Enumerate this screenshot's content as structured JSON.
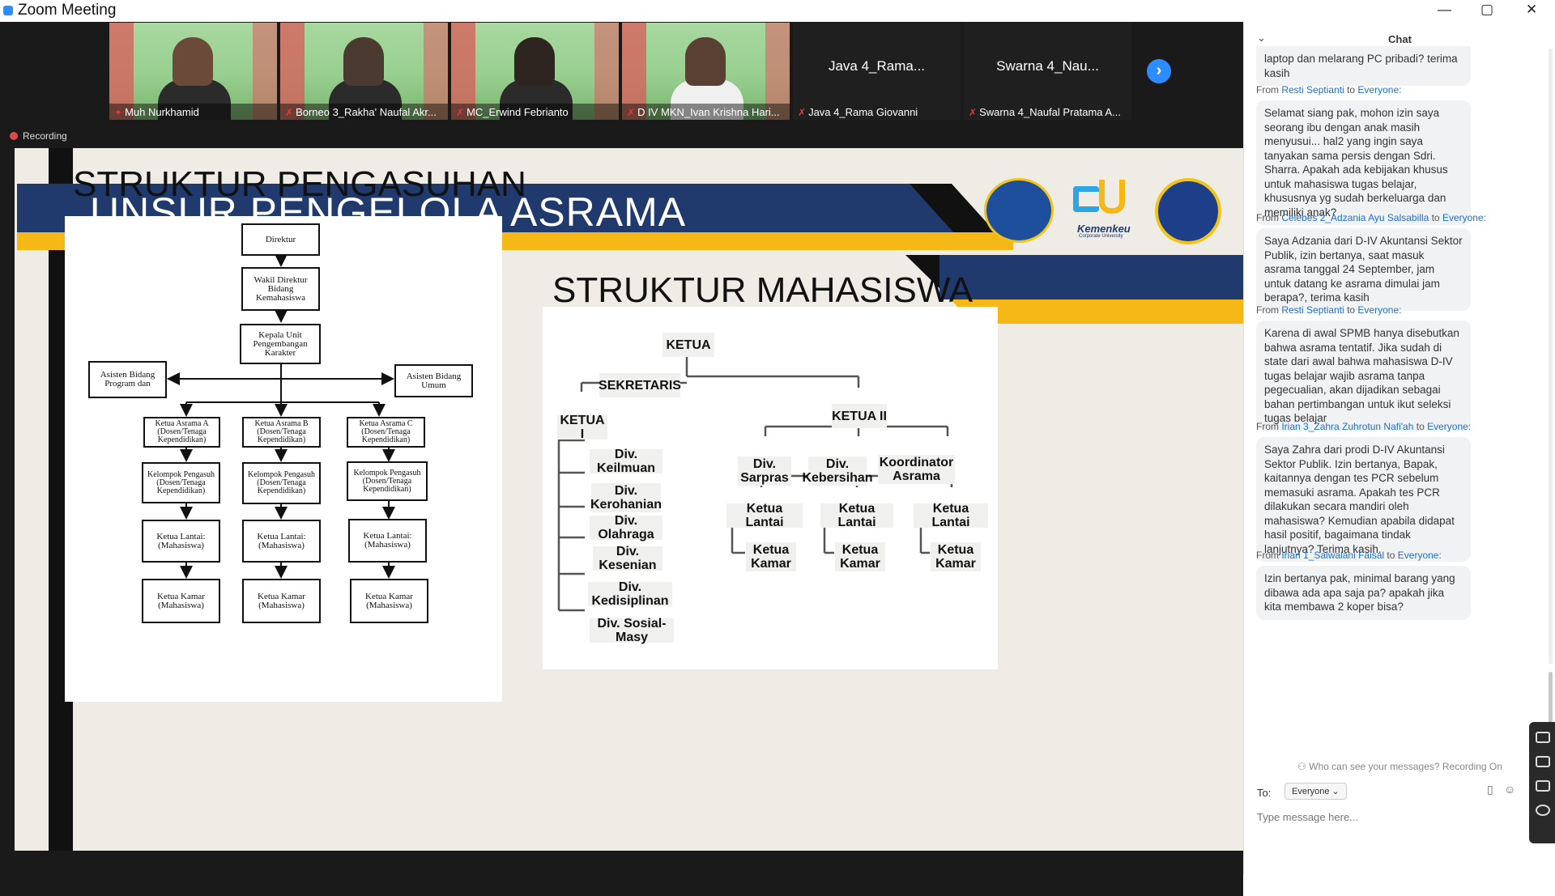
{
  "window": {
    "title": "Zoom Meeting",
    "minimize": "—",
    "maximize": "▢",
    "close": "✕"
  },
  "participants": [
    {
      "name": "Muh Nurkhamid",
      "video": true,
      "active": true
    },
    {
      "name": "Borneo 3_Rakha' Naufal Akr...",
      "video": true
    },
    {
      "name": "MC_Erwind Febrianto",
      "video": true
    },
    {
      "name": "D IV MKN_Ivan Krishna Hari...",
      "video": true
    },
    {
      "name": "Java 4_Rama Giovanni",
      "big": "Java 4_Rama...",
      "video": false
    },
    {
      "name": "Swarna 4_Naufal Pratama A...",
      "big": "Swarna 4_Nau...",
      "video": false
    }
  ],
  "recording": "Recording",
  "slide": {
    "title": "UNSUR PENGELOLA ASRAMA",
    "left_heading": "STRUKTUR PENGASUHAN",
    "right_heading": "STRUKTUR MAHASISWA",
    "logo2_text": "Kemenkeu",
    "logo2_sub": "Corporate University",
    "pengasuhan": {
      "direktur": "Direktur",
      "wakil": "Wakil Direktur Bidang Kemahasiswa",
      "kepala": "Kepala Unit Pengembangan Karakter",
      "asisten_prog": "Asisten Bidang Program dan",
      "asisten_umum": "Asisten Bidang Umum",
      "ketua_a": "Ketua Asrama A (Dosen/Tenaga Kependidikan)",
      "ketua_b": "Ketua Asrama B (Dosen/Tenaga Kependidikan)",
      "ketua_c": "Ketua Asrama C (Dosen/Tenaga Kependidikan)",
      "kelompok": "Kelompok Pengasuh (Dosen/Tenaga Kependidikan)",
      "lantai": "Ketua Lantai: (Mahasiswa)",
      "kamar": "Ketua Kamar (Mahasiswa)"
    },
    "mahasiswa": {
      "ketua": "KETUA",
      "sekretaris": "SEKRETARIS",
      "ketua1": "KETUA I",
      "ketua2": "KETUA II",
      "divs": [
        "Div. Keilmuan",
        "Div. Kerohanian",
        "Div. Olahraga",
        "Div. Kesenian",
        "Div. Kedisiplinan",
        "Div. Sosial-Masy"
      ],
      "sarpras": "Div. Sarpras",
      "kebersihan": "Div. Kebersihan",
      "koordinator": "Koordinator Asrama",
      "ketua_lantai": "Ketua Lantai",
      "ketua_kamar": "Ketua Kamar"
    }
  },
  "chat": {
    "title": "Chat",
    "top_fragment": "laptop dan melarang PC pribadi? terima kasih",
    "messages": [
      {
        "from": "Resti Septianti",
        "to": "Everyone:",
        "text": "Selamat siang pak, mohon izin saya seorang ibu dengan anak masih menyusui... hal2 yang ingin saya tanyakan sama persis dengan Sdri. Sharra. Apakah ada kebijakan khusus untuk mahasiswa tugas belajar, khususnya yg sudah berkeluarga dan memiliki anak?"
      },
      {
        "from": "Celebes 2_Adzania Ayu Salsabilla",
        "to": "Everyone:",
        "text": "Saya Adzania dari D-IV Akuntansi Sektor Publik, izin bertanya, saat masuk asrama tanggal 24 September, jam untuk datang ke asrama dimulai jam berapa?, terima kasih"
      },
      {
        "from": "Resti Septianti",
        "to": "Everyone:",
        "text": "Karena di awal SPMB hanya disebutkan bahwa asrama tentatif. Jika sudah di state dari awal bahwa mahasiswa D-IV tugas belajar wajib asrama tanpa pegecualian, akan dijadikan sebagai bahan pertimbangan untuk ikut seleksi tugas belajar"
      },
      {
        "from": "Irian 3_Zahra Zuhrotun Nafi'ah",
        "to": "Everyone:",
        "text": "Saya Zahra dari prodi D-IV Akuntansi Sektor Publik. Izin bertanya, Bapak, kaitannya dengan tes PCR sebelum memasuki asrama. Apakah tes PCR dilakukan secara mandiri oleh mahasiswa? Kemudian apabila didapat hasil positif, bagaimana tindak lanjutnya? Terima kasih."
      },
      {
        "from": "Irian 1_Salwalani Faisal",
        "to": "Everyone:",
        "text": "Izin bertanya pak, minimal barang yang dibawa ada apa saja pa? apakah jika kita membawa 2 koper bisa?"
      }
    ],
    "from_label": "From",
    "to_word": "to",
    "privacy": "Who can see your messages? Recording On",
    "to_label": "To:",
    "to_value": "Everyone ⌄",
    "placeholder": "Type message here..."
  }
}
